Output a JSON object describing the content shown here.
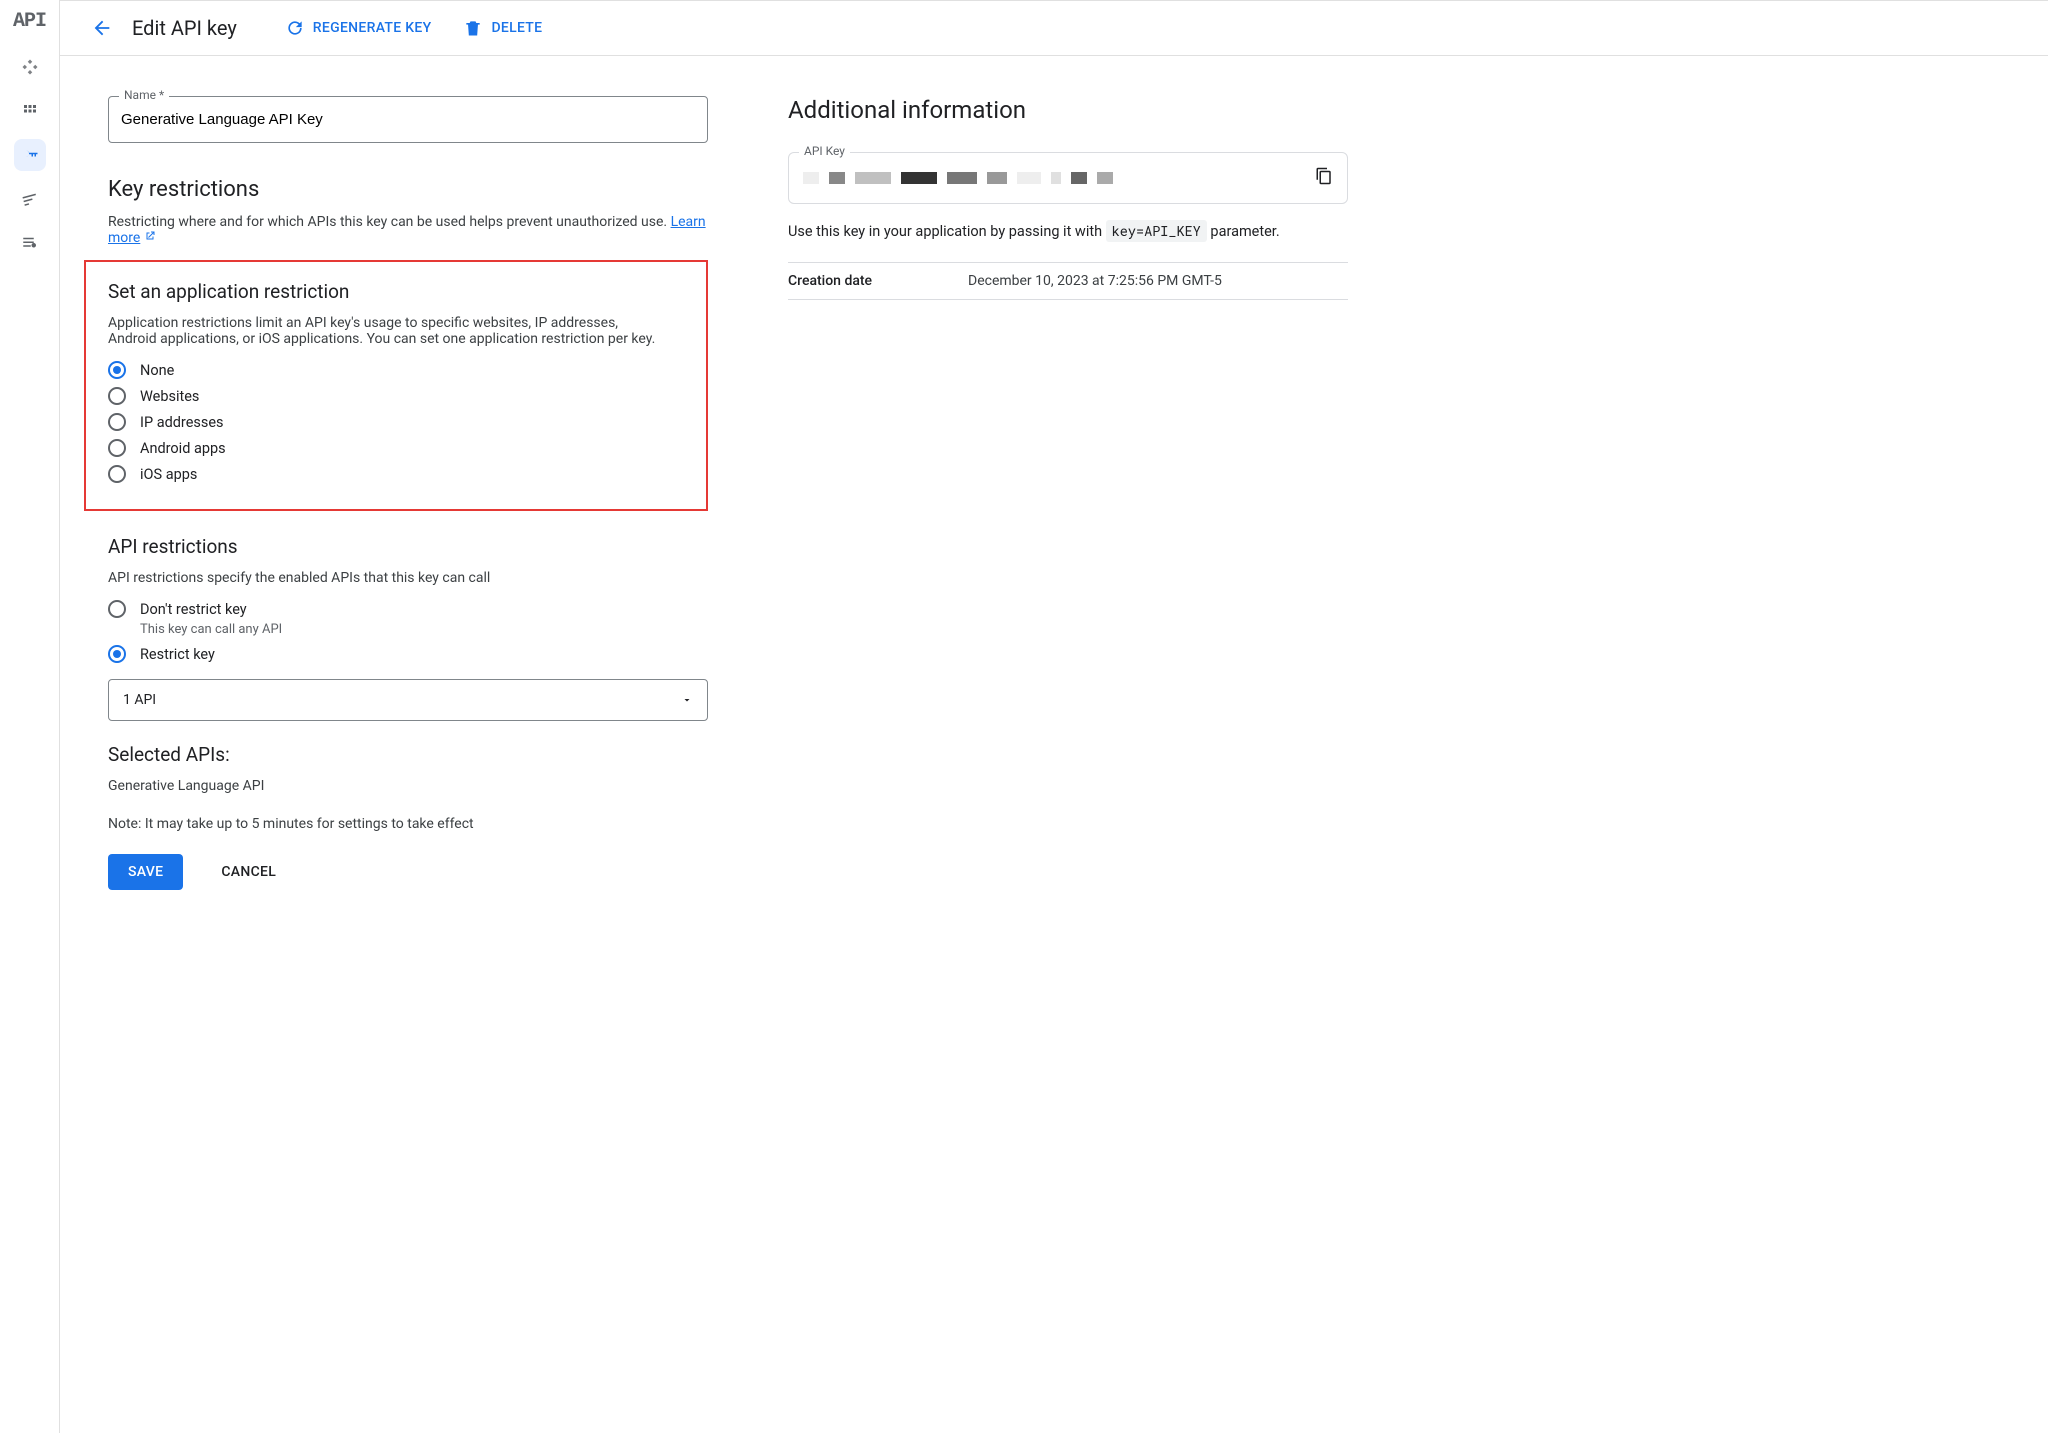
{
  "sidebar": {
    "logo": "API"
  },
  "header": {
    "title": "Edit API key",
    "regenerate": "REGENERATE KEY",
    "delete": "DELETE"
  },
  "nameField": {
    "label": "Name *",
    "value": "Generative Language API Key"
  },
  "keyRestrictions": {
    "title": "Key restrictions",
    "desc": "Restricting where and for which APIs this key can be used helps prevent unauthorized use. ",
    "learnMore": "Learn more"
  },
  "appRestriction": {
    "title": "Set an application restriction",
    "desc": "Application restrictions limit an API key's usage to specific websites, IP addresses, Android applications, or iOS applications. You can set one application restriction per key.",
    "options": [
      "None",
      "Websites",
      "IP addresses",
      "Android apps",
      "iOS apps"
    ],
    "selected": "None"
  },
  "apiRestrictions": {
    "title": "API restrictions",
    "desc": "API restrictions specify the enabled APIs that this key can call",
    "options": [
      {
        "label": "Don't restrict key",
        "sub": "This key can call any API"
      },
      {
        "label": "Restrict key",
        "sub": ""
      }
    ],
    "selected": "Restrict key",
    "selectValue": "1 API",
    "selectedApisTitle": "Selected APIs:",
    "selectedApis": [
      "Generative Language API"
    ]
  },
  "note": "Note: It may take up to 5 minutes for settings to take effect",
  "buttons": {
    "save": "SAVE",
    "cancel": "CANCEL"
  },
  "additional": {
    "title": "Additional information",
    "apiKeyLabel": "API Key",
    "hintPrefix": "Use this key in your application by passing it with ",
    "hintCode": "key=API_KEY",
    "hintSuffix": " parameter.",
    "creationLabel": "Creation date",
    "creationValue": "December 10, 2023 at 7:25:56 PM GMT-5"
  }
}
